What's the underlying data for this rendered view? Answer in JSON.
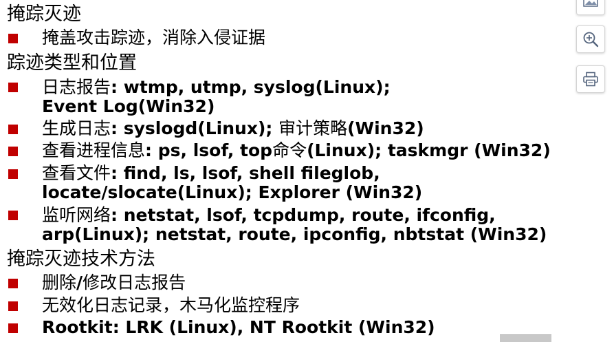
{
  "colors": {
    "bullet": "#c00000",
    "text": "#000000"
  },
  "headings": [
    "掩踪灭迹",
    "踪迹类型和位置",
    "掩踪灭迹技术方法"
  ],
  "items": {
    "i1": {
      "cn": "掩盖攻击踪迹，消除入侵证据"
    },
    "i2": {
      "cn": "日志报告",
      "en1": ": wtmp, utmp, syslog(Linux);",
      "line2": "Event Log(Win32)"
    },
    "i3": {
      "cn": "生成日志",
      "en1": ": syslogd(Linux); ",
      "cn2": "审计策略",
      "en2": "(Win32)"
    },
    "i4": {
      "cn": "查看进程信息",
      "en1": ": ps, lsof, top",
      "cn2": "命令",
      "en2": "(Linux); taskmgr (Win32)"
    },
    "i5": {
      "cn": "查看文件",
      "en1": ": find, ls, lsof, shell fileglob,",
      "line2": "locate/slocate(Linux); Explorer (Win32)"
    },
    "i6": {
      "cn": "监听网络",
      "en1": ": netstat, lsof, tcpdump, route, ifconfig,",
      "line2": "arp(Linux); netstat, route, ipconfig, nbtstat (Win32)"
    },
    "i7": {
      "cn1": "删除",
      "slash": "/",
      "cn2": "修改日志报告"
    },
    "i8": {
      "cn": "无效化日志记录，木马化监控程序"
    },
    "i9": {
      "en": "Rootkit: LRK (Linux), NT Rootkit (Win32)"
    }
  },
  "toolbar": {
    "icons": [
      "image-icon",
      "zoom-in-icon",
      "print-icon"
    ]
  }
}
